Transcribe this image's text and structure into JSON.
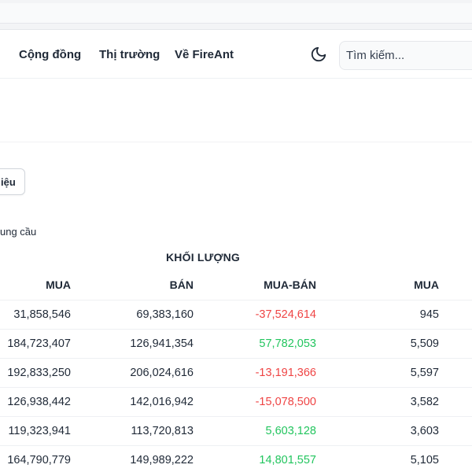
{
  "nav": {
    "links": [
      "Cộng đồng",
      "Thị trường",
      "Về FireAnt"
    ],
    "search_placeholder": "Tìm kiếm..."
  },
  "toolbar": {
    "partial_button_label": "iệu"
  },
  "section": {
    "partial_label": "ung cầu"
  },
  "table": {
    "group_title": "KHỐI LƯỢNG",
    "headers": [
      "MUA",
      "BÁN",
      "MUA-BÁN",
      "MUA"
    ],
    "rows": [
      [
        "31,858,546",
        "69,383,160",
        "-37,524,614",
        "945"
      ],
      [
        "184,723,407",
        "126,941,354",
        "57,782,053",
        "5,509"
      ],
      [
        "192,833,250",
        "206,024,616",
        "-13,191,366",
        "5,597"
      ],
      [
        "126,938,442",
        "142,016,942",
        "-15,078,500",
        "3,582"
      ],
      [
        "119,323,941",
        "113,720,813",
        "5,603,128",
        "3,603"
      ],
      [
        "164,790,779",
        "149,989,222",
        "14,801,557",
        "5,105"
      ]
    ],
    "diff_signs": [
      "neg",
      "pos",
      "neg",
      "neg",
      "pos",
      "pos"
    ]
  },
  "colors": {
    "negative": "#ef4444",
    "positive": "#22c55e"
  }
}
